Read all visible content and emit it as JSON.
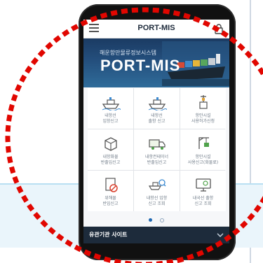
{
  "app": {
    "title": "PORT-MIS",
    "hero_subtitle": "해운항만물류정보시스템",
    "hero_title": "PORT-MIS"
  },
  "menu_items": [
    {
      "label": "내항선\n입항신고",
      "icon": "ship-arrive-icon"
    },
    {
      "label": "내항선\n출항 신고",
      "icon": "ship-depart-icon"
    },
    {
      "label": "항만시설\n사용허가신청",
      "icon": "crane-icon"
    },
    {
      "label": "내항화물\n반출입신고",
      "icon": "cargo-box-icon"
    },
    {
      "label": "내항컨테이너\n반출입신고",
      "icon": "truck-icon"
    },
    {
      "label": "항만시설\n사용신고(화물료)",
      "icon": "crane-cargo-icon"
    },
    {
      "label": "위해물\n반입신고",
      "icon": "hazard-doc-icon"
    },
    {
      "label": "내항선 입항\n신고 조회",
      "icon": "ship-search-icon"
    },
    {
      "label": "내국선 출항\n신고 조회",
      "icon": "monitor-icon"
    }
  ],
  "pager": {
    "pages": 2,
    "active": 1
  },
  "footer": {
    "text": "유관기관 사이트"
  },
  "colors": {
    "accent": "#1e67b1",
    "footer_bg": "#1d2b3b",
    "hero_bg": "#244f7d",
    "highlight_circle": "#e10600"
  }
}
